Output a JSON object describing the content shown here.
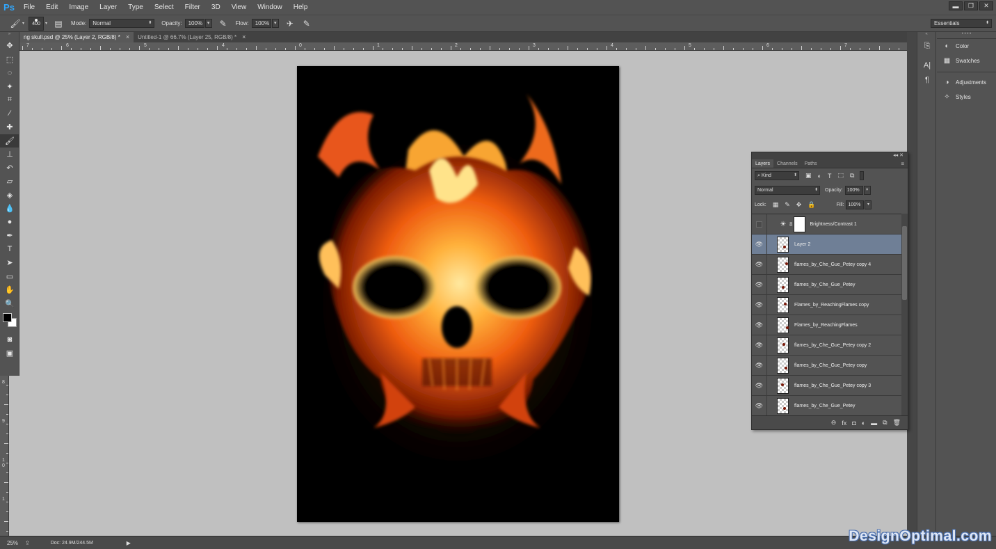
{
  "app": {
    "logo": "Ps",
    "menu": [
      "File",
      "Edit",
      "Image",
      "Layer",
      "Type",
      "Select",
      "Filter",
      "3D",
      "View",
      "Window",
      "Help"
    ],
    "window_buttons": [
      "▬",
      "❐",
      "✕"
    ]
  },
  "options": {
    "brush_size": "400",
    "mode_label": "Mode:",
    "mode_value": "Normal",
    "opacity_label": "Opacity:",
    "opacity_value": "100%",
    "flow_label": "Flow:",
    "flow_value": "100%",
    "workspace": "Essentials"
  },
  "tabs": [
    {
      "label": "ng skull.psd @ 25% (Layer 2, RGB/8) *",
      "close": "×"
    },
    {
      "label": "Untitled-1 @ 66.7% (Layer 25, RGB/8) *",
      "close": "×"
    }
  ],
  "ruler_h": [
    {
      "label": "7",
      "pos": 10
    },
    {
      "label": "6",
      "pos": 67
    },
    {
      "label": "5",
      "pos": 179
    },
    {
      "label": "4",
      "pos": 291
    },
    {
      "label": "0",
      "pos": 402
    },
    {
      "label": "1",
      "pos": 514
    },
    {
      "label": "2",
      "pos": 626
    },
    {
      "label": "3",
      "pos": 738
    },
    {
      "label": "4",
      "pos": 850
    },
    {
      "label": "5",
      "pos": 962
    },
    {
      "label": "6",
      "pos": 1074
    },
    {
      "label": "7",
      "pos": 1186
    }
  ],
  "ruler_v": [
    {
      "label": "8",
      "pos": 473
    },
    {
      "label": "9",
      "pos": 529
    },
    {
      "label": "1",
      "pos": 585
    },
    {
      "label": "0",
      "pos": 593
    },
    {
      "label": "1",
      "pos": 641
    }
  ],
  "status": {
    "zoom": "25%",
    "doc": "Doc: 24.9M/244.5M",
    "arrow": "▶"
  },
  "watermark": "DesignOptimal.com",
  "dock": {
    "items": [
      {
        "label": "Color",
        "icon": "color-icon"
      },
      {
        "label": "Swatches",
        "icon": "swatches-icon"
      },
      {
        "label": "Adjustments",
        "icon": "adjustments-icon"
      },
      {
        "label": "Styles",
        "icon": "styles-icon"
      }
    ]
  },
  "layers_panel": {
    "tabs": [
      "Layers",
      "Channels",
      "Paths"
    ],
    "filter_kind": "Kind",
    "blend_mode": "Normal",
    "opacity_label": "Opacity:",
    "opacity_value": "100%",
    "lock_label": "Lock:",
    "fill_label": "Fill:",
    "fill_value": "100%",
    "layers": [
      {
        "name": "Brightness/Contrast 1",
        "type": "adjustment",
        "visible": false,
        "selected": false
      },
      {
        "name": "Layer 2",
        "type": "pixel",
        "visible": true,
        "selected": true
      },
      {
        "name": "flames_by_Che_Gue_Petey copy 4",
        "type": "pixel",
        "visible": true,
        "selected": false
      },
      {
        "name": "flames_by_Che_Gue_Petey",
        "type": "pixel",
        "visible": true,
        "selected": false
      },
      {
        "name": "Flames_by_ReachingFlames copy",
        "type": "pixel",
        "visible": true,
        "selected": false
      },
      {
        "name": "Flames_by_ReachingFlames",
        "type": "pixel",
        "visible": true,
        "selected": false
      },
      {
        "name": "flames_by_Che_Gue_Petey copy 2",
        "type": "pixel",
        "visible": true,
        "selected": false
      },
      {
        "name": "flames_by_Che_Gue_Petey copy",
        "type": "pixel",
        "visible": true,
        "selected": false
      },
      {
        "name": "flames_by_Che_Gue_Petey copy 3",
        "type": "pixel",
        "visible": true,
        "selected": false
      },
      {
        "name": "flames_by_Che_Gue_Petey",
        "type": "pixel",
        "visible": true,
        "selected": false
      }
    ]
  }
}
